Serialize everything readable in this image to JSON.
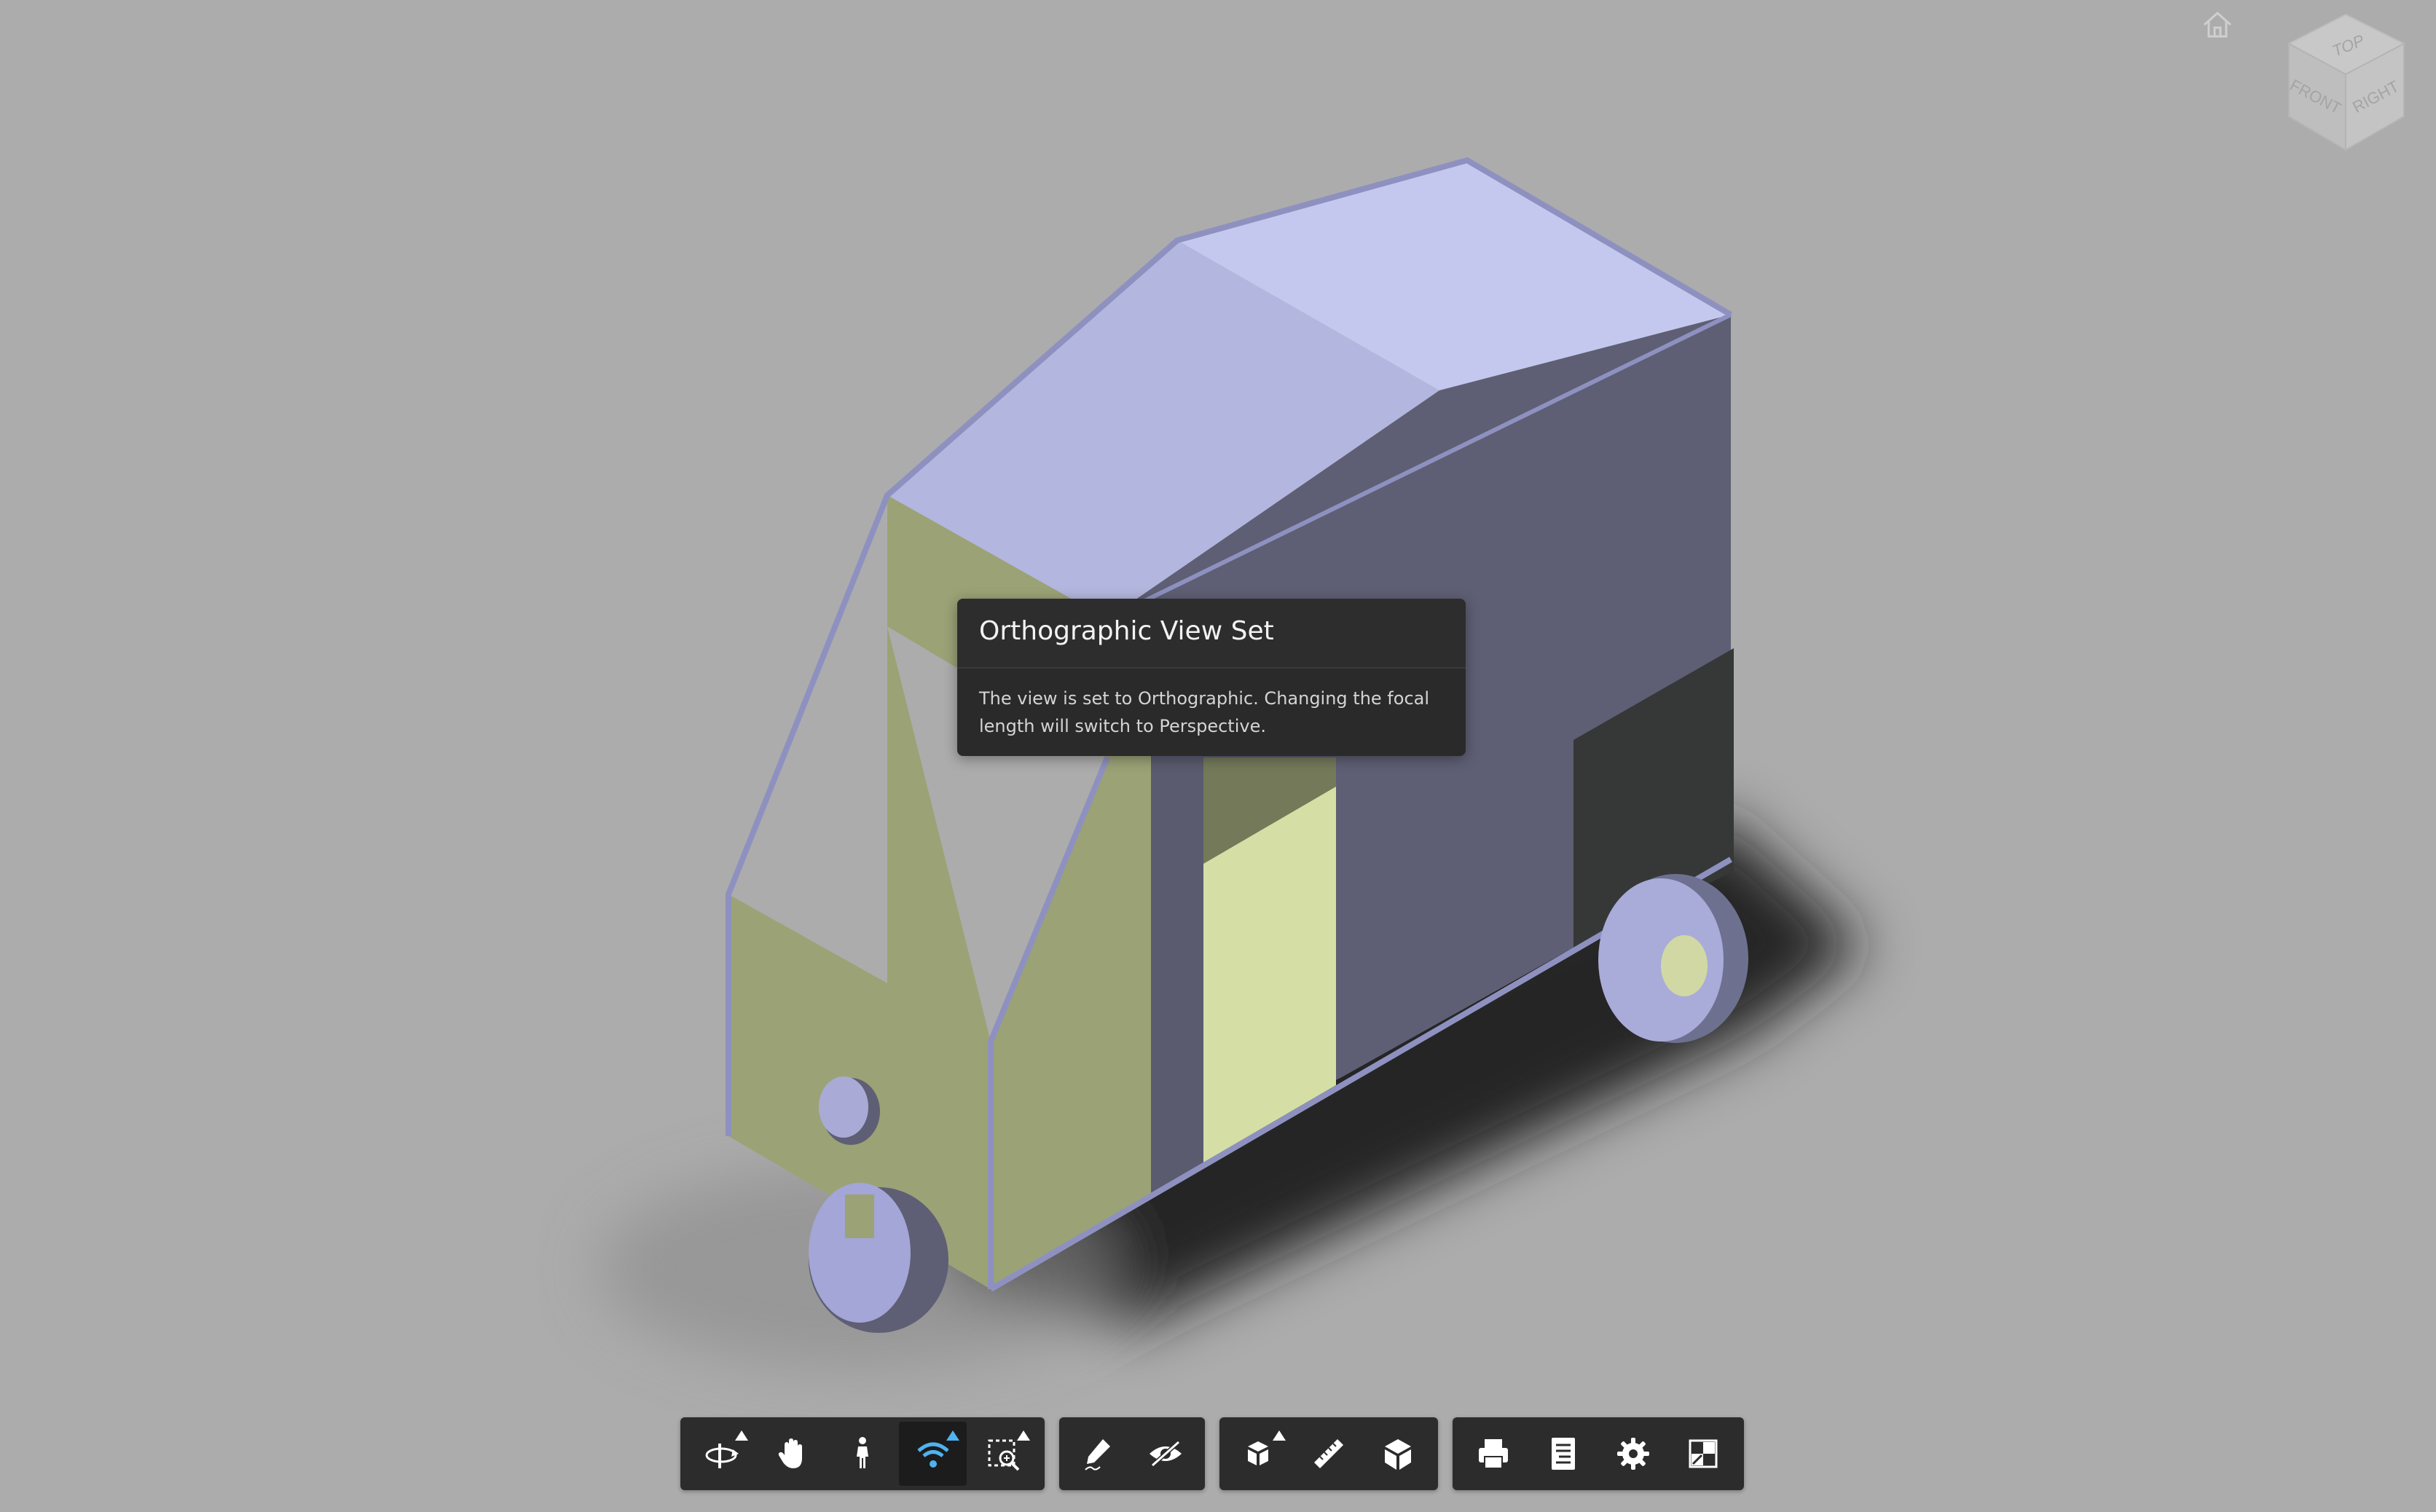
{
  "viewcube": {
    "top": "TOP",
    "front": "FRONT",
    "right": "RIGHT"
  },
  "tooltip": {
    "title": "Orthographic View Set",
    "body": "The view is set to Orthographic. Changing the focal length will switch to Perspective."
  },
  "toolbar_groups": [
    {
      "name": "navigation",
      "buttons": [
        "orbit-icon",
        "pan-icon",
        "first-person-icon",
        "camera-interactions-icon",
        "fit-to-view-icon"
      ]
    },
    {
      "name": "markup",
      "buttons": [
        "markup-pencil-icon",
        "hide-object-icon"
      ]
    },
    {
      "name": "analysis",
      "buttons": [
        "explode-model-icon",
        "measure-ruler-icon",
        "section-box-icon"
      ]
    },
    {
      "name": "settings",
      "buttons": [
        "print-icon",
        "model-browser-icon",
        "settings-gear-icon",
        "fullscreen-icon"
      ]
    }
  ],
  "colors": {
    "background": "#acacac",
    "toolbar": "#2c2c2c",
    "accent": "#4fb3f0",
    "model_roof": "#c5c8ee",
    "model_side": "#5e5f74",
    "model_olive": "#9ba276",
    "model_yellow": "#d5dfa5"
  }
}
